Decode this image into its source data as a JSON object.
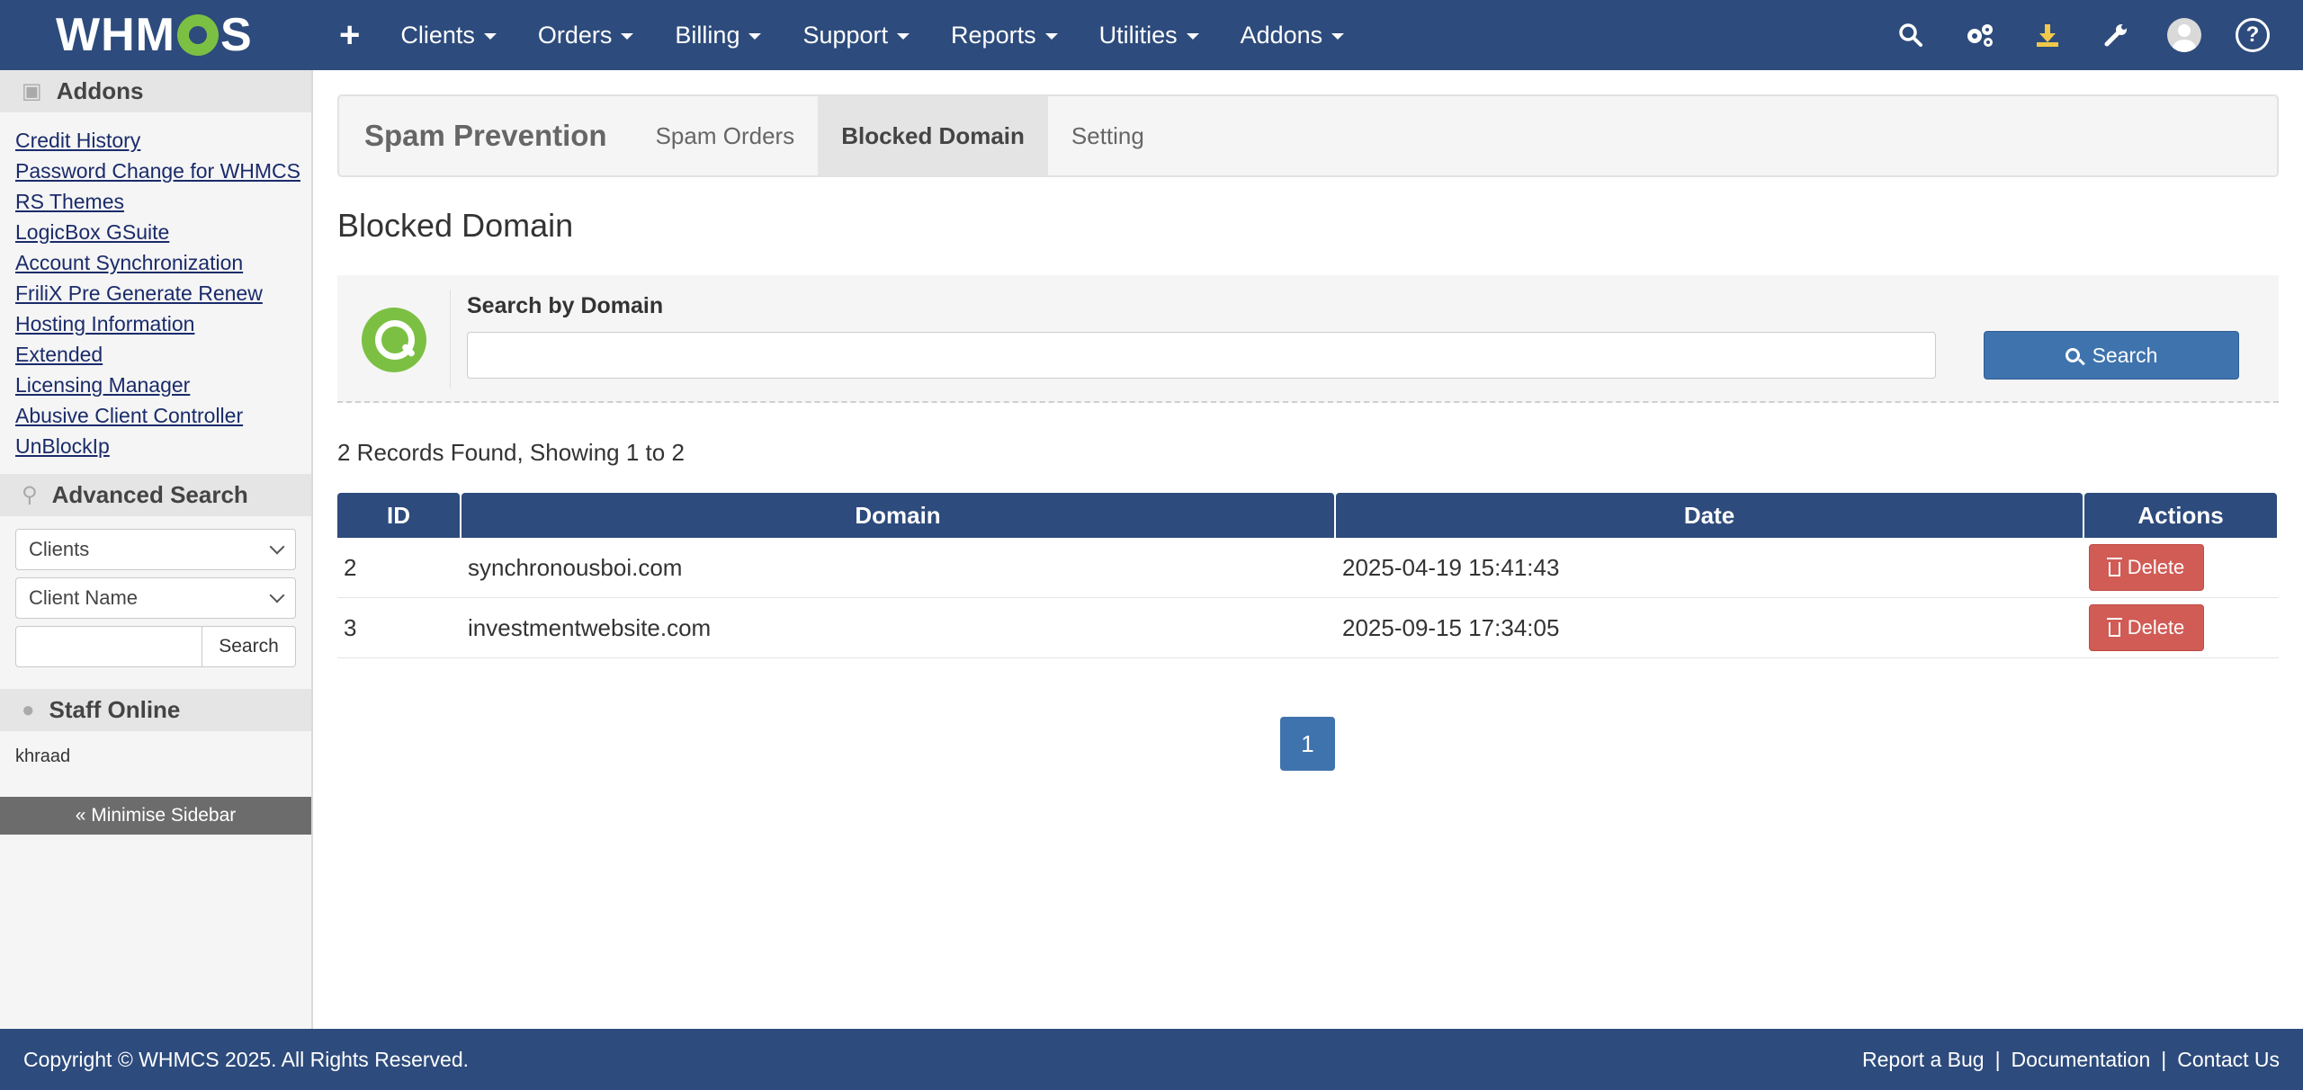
{
  "brand": {
    "logo_left": "WHM",
    "logo_right": "S"
  },
  "nav": {
    "plus": "+",
    "items": [
      {
        "label": "Clients"
      },
      {
        "label": "Orders"
      },
      {
        "label": "Billing"
      },
      {
        "label": "Support"
      },
      {
        "label": "Reports"
      },
      {
        "label": "Utilities"
      },
      {
        "label": "Addons"
      }
    ],
    "icons": [
      "search-icon",
      "cogs-icon",
      "download-icon",
      "wrench-icon",
      "avatar",
      "help-icon"
    ],
    "help_glyph": "?"
  },
  "sidebar": {
    "addons_title": "Addons",
    "addon_links": [
      "Credit History",
      "Password Change for WHMCS",
      "RS Themes",
      "LogicBox GSuite",
      "Account Synchronization",
      "FriliX Pre Generate Renew",
      "Hosting Information Extended",
      "Licensing Manager",
      "Abusive Client Controller",
      "UnBlockIp"
    ],
    "advanced_search_title": "Advanced Search",
    "search_type": "Clients",
    "search_field": "Client Name",
    "search_button": "Search",
    "staff_title": "Staff Online",
    "staff_name": "khraad",
    "minimise": "« Minimise Sidebar"
  },
  "module": {
    "title": "Spam Prevention",
    "tabs": [
      {
        "label": "Spam Orders",
        "active": false
      },
      {
        "label": "Blocked Domain",
        "active": true
      },
      {
        "label": "Setting",
        "active": false
      }
    ]
  },
  "page": {
    "title": "Blocked Domain",
    "search_label": "Search by Domain",
    "search_value": "",
    "search_button": "Search",
    "records": "2 Records Found, Showing 1 to 2"
  },
  "table": {
    "headers": {
      "id": "ID",
      "domain": "Domain",
      "date": "Date",
      "actions": "Actions"
    },
    "rows": [
      {
        "id": "2",
        "domain": "synchronousboi.com",
        "date": "2025-04-19 15:41:43",
        "action": "Delete"
      },
      {
        "id": "3",
        "domain": "investmentwebsite.com",
        "date": "2025-09-15 17:34:05",
        "action": "Delete"
      }
    ]
  },
  "pagination": {
    "current": "1"
  },
  "footer": {
    "copyright": "Copyright © WHMCS 2025. All Rights Reserved.",
    "links": [
      "Report a Bug",
      "Documentation",
      "Contact Us"
    ],
    "separator": "|"
  },
  "colors": {
    "navbar": "#2d4b7c",
    "accent": "#3f73ad",
    "danger": "#d15b55",
    "logo_green": "#7cc043"
  }
}
